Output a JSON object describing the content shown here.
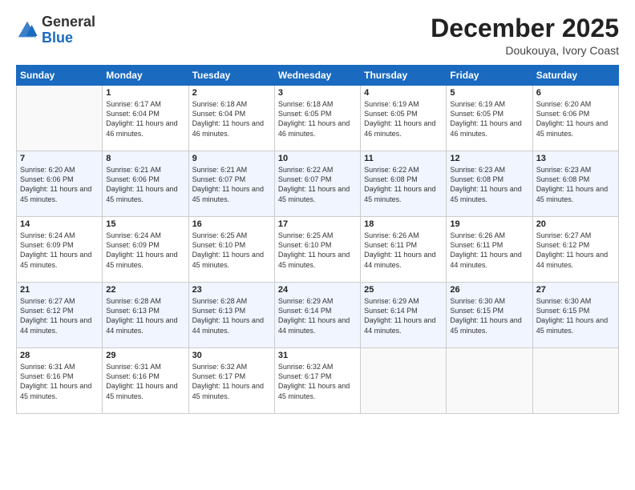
{
  "header": {
    "logo_general": "General",
    "logo_blue": "Blue",
    "month_title": "December 2025",
    "location": "Doukouya, Ivory Coast"
  },
  "weekdays": [
    "Sunday",
    "Monday",
    "Tuesday",
    "Wednesday",
    "Thursday",
    "Friday",
    "Saturday"
  ],
  "rows": [
    [
      {
        "day": "",
        "info": ""
      },
      {
        "day": "1",
        "info": "Sunrise: 6:17 AM\nSunset: 6:04 PM\nDaylight: 11 hours and 46 minutes."
      },
      {
        "day": "2",
        "info": "Sunrise: 6:18 AM\nSunset: 6:04 PM\nDaylight: 11 hours and 46 minutes."
      },
      {
        "day": "3",
        "info": "Sunrise: 6:18 AM\nSunset: 6:05 PM\nDaylight: 11 hours and 46 minutes."
      },
      {
        "day": "4",
        "info": "Sunrise: 6:19 AM\nSunset: 6:05 PM\nDaylight: 11 hours and 46 minutes."
      },
      {
        "day": "5",
        "info": "Sunrise: 6:19 AM\nSunset: 6:05 PM\nDaylight: 11 hours and 46 minutes."
      },
      {
        "day": "6",
        "info": "Sunrise: 6:20 AM\nSunset: 6:06 PM\nDaylight: 11 hours and 45 minutes."
      }
    ],
    [
      {
        "day": "7",
        "info": "Sunrise: 6:20 AM\nSunset: 6:06 PM\nDaylight: 11 hours and 45 minutes."
      },
      {
        "day": "8",
        "info": "Sunrise: 6:21 AM\nSunset: 6:06 PM\nDaylight: 11 hours and 45 minutes."
      },
      {
        "day": "9",
        "info": "Sunrise: 6:21 AM\nSunset: 6:07 PM\nDaylight: 11 hours and 45 minutes."
      },
      {
        "day": "10",
        "info": "Sunrise: 6:22 AM\nSunset: 6:07 PM\nDaylight: 11 hours and 45 minutes."
      },
      {
        "day": "11",
        "info": "Sunrise: 6:22 AM\nSunset: 6:08 PM\nDaylight: 11 hours and 45 minutes."
      },
      {
        "day": "12",
        "info": "Sunrise: 6:23 AM\nSunset: 6:08 PM\nDaylight: 11 hours and 45 minutes."
      },
      {
        "day": "13",
        "info": "Sunrise: 6:23 AM\nSunset: 6:08 PM\nDaylight: 11 hours and 45 minutes."
      }
    ],
    [
      {
        "day": "14",
        "info": "Sunrise: 6:24 AM\nSunset: 6:09 PM\nDaylight: 11 hours and 45 minutes."
      },
      {
        "day": "15",
        "info": "Sunrise: 6:24 AM\nSunset: 6:09 PM\nDaylight: 11 hours and 45 minutes."
      },
      {
        "day": "16",
        "info": "Sunrise: 6:25 AM\nSunset: 6:10 PM\nDaylight: 11 hours and 45 minutes."
      },
      {
        "day": "17",
        "info": "Sunrise: 6:25 AM\nSunset: 6:10 PM\nDaylight: 11 hours and 45 minutes."
      },
      {
        "day": "18",
        "info": "Sunrise: 6:26 AM\nSunset: 6:11 PM\nDaylight: 11 hours and 44 minutes."
      },
      {
        "day": "19",
        "info": "Sunrise: 6:26 AM\nSunset: 6:11 PM\nDaylight: 11 hours and 44 minutes."
      },
      {
        "day": "20",
        "info": "Sunrise: 6:27 AM\nSunset: 6:12 PM\nDaylight: 11 hours and 44 minutes."
      }
    ],
    [
      {
        "day": "21",
        "info": "Sunrise: 6:27 AM\nSunset: 6:12 PM\nDaylight: 11 hours and 44 minutes."
      },
      {
        "day": "22",
        "info": "Sunrise: 6:28 AM\nSunset: 6:13 PM\nDaylight: 11 hours and 44 minutes."
      },
      {
        "day": "23",
        "info": "Sunrise: 6:28 AM\nSunset: 6:13 PM\nDaylight: 11 hours and 44 minutes."
      },
      {
        "day": "24",
        "info": "Sunrise: 6:29 AM\nSunset: 6:14 PM\nDaylight: 11 hours and 44 minutes."
      },
      {
        "day": "25",
        "info": "Sunrise: 6:29 AM\nSunset: 6:14 PM\nDaylight: 11 hours and 44 minutes."
      },
      {
        "day": "26",
        "info": "Sunrise: 6:30 AM\nSunset: 6:15 PM\nDaylight: 11 hours and 45 minutes."
      },
      {
        "day": "27",
        "info": "Sunrise: 6:30 AM\nSunset: 6:15 PM\nDaylight: 11 hours and 45 minutes."
      }
    ],
    [
      {
        "day": "28",
        "info": "Sunrise: 6:31 AM\nSunset: 6:16 PM\nDaylight: 11 hours and 45 minutes."
      },
      {
        "day": "29",
        "info": "Sunrise: 6:31 AM\nSunset: 6:16 PM\nDaylight: 11 hours and 45 minutes."
      },
      {
        "day": "30",
        "info": "Sunrise: 6:32 AM\nSunset: 6:17 PM\nDaylight: 11 hours and 45 minutes."
      },
      {
        "day": "31",
        "info": "Sunrise: 6:32 AM\nSunset: 6:17 PM\nDaylight: 11 hours and 45 minutes."
      },
      {
        "day": "",
        "info": ""
      },
      {
        "day": "",
        "info": ""
      },
      {
        "day": "",
        "info": ""
      }
    ]
  ]
}
